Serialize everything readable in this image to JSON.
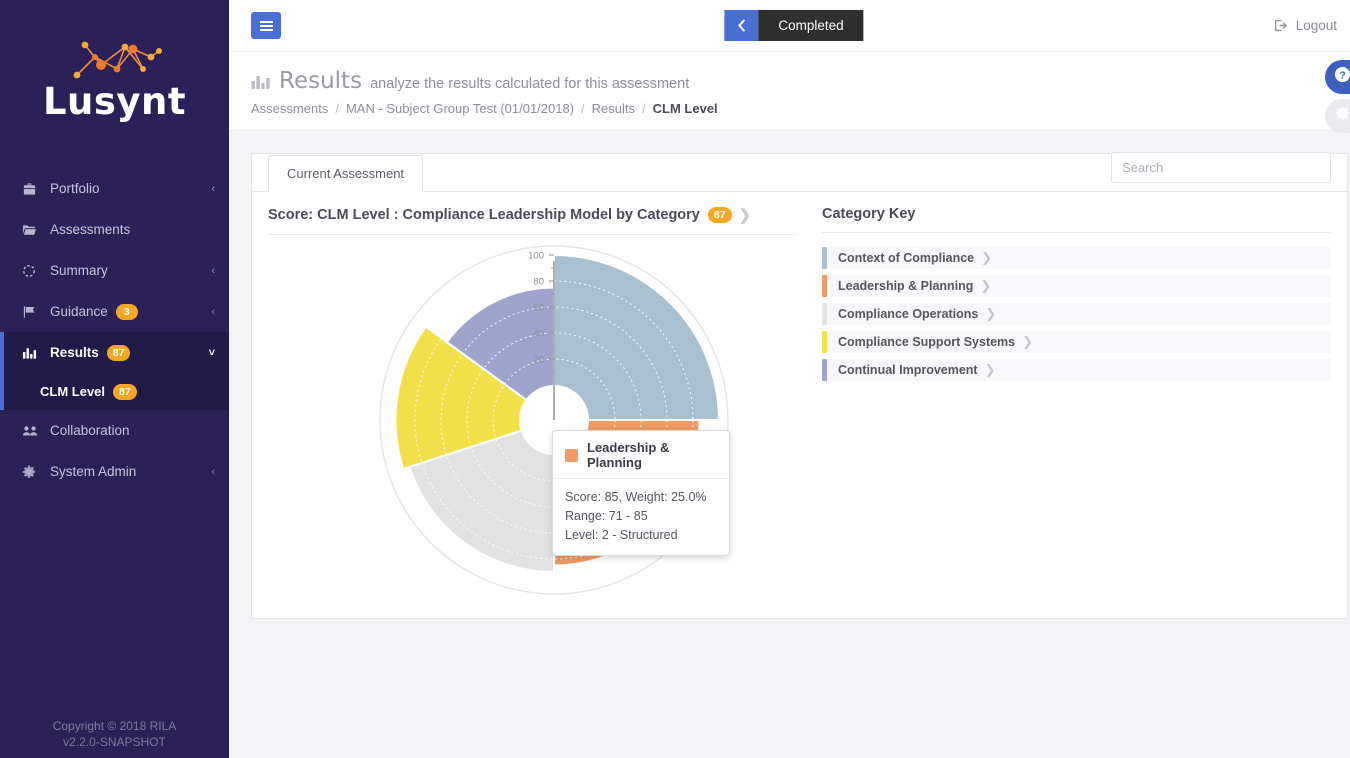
{
  "brand": {
    "name": "Lusynt",
    "logo_icon": "network-logo-icon"
  },
  "sidebar": {
    "items": [
      {
        "label": "Portfolio",
        "icon": "briefcase-icon",
        "chevron": "‹",
        "badge": null
      },
      {
        "label": "Assessments",
        "icon": "folder-open-icon",
        "chevron": "",
        "badge": null
      },
      {
        "label": "Summary",
        "icon": "circle-dashed-icon",
        "chevron": "‹",
        "badge": null
      },
      {
        "label": "Guidance",
        "icon": "flag-icon",
        "chevron": "‹",
        "badge": "3"
      },
      {
        "label": "Results",
        "icon": "bar-chart-icon",
        "chevron": "˅",
        "badge": "87"
      },
      {
        "label": "Collaboration",
        "icon": "users-icon",
        "chevron": "",
        "badge": null
      },
      {
        "label": "System Admin",
        "icon": "gear-icon",
        "chevron": "‹",
        "badge": null
      }
    ],
    "subitem": {
      "label": "CLM Level",
      "badge": "87"
    },
    "footer": {
      "copyright": "Copyright © 2018 RILA",
      "version": "v2.2.0-SNAPSHOT"
    }
  },
  "topbar": {
    "menu_icon": "hamburger-icon",
    "back_icon": "chevron-left-icon",
    "status": "Completed",
    "logout": "Logout",
    "logout_icon": "logout-icon"
  },
  "page_header": {
    "icon": "bar-chart-icon",
    "title": "Results",
    "subtitle": "analyze the results calculated for this assessment",
    "breadcrumb": [
      {
        "label": "Assessments",
        "current": false
      },
      {
        "label": "MAN - Subject Group Test (01/01/2018)",
        "current": false
      },
      {
        "label": "Results",
        "current": false
      },
      {
        "label": "CLM Level",
        "current": true
      }
    ],
    "breadcrumb_separator": "/"
  },
  "panel": {
    "tab": "Current Assessment",
    "search_placeholder": "Search",
    "search_value": "",
    "chart_title": "Score: CLM Level : Compliance Leadership Model by Category",
    "chart_title_badge": "87",
    "chart_title_chevron": "❯",
    "key_title": "Category Key"
  },
  "category_key": {
    "chevron": "❯",
    "items": [
      {
        "label": "Context of Compliance",
        "color": "#a8c0cf"
      },
      {
        "label": "Leadership & Planning",
        "color": "#f09a64"
      },
      {
        "label": "Compliance Operations",
        "color": "#e2e2e2"
      },
      {
        "label": "Compliance Support Systems",
        "color": "#f2e04a"
      },
      {
        "label": "Continual Improvement",
        "color": "#9fa4cd"
      }
    ]
  },
  "tooltip": {
    "title": "Leadership & Planning",
    "color": "#f09a64",
    "line1": "Score: 85,  Weight: 25.0%",
    "line2": "Range: 71 - 85",
    "line3": "Level: 2 - Structured"
  },
  "fab": {
    "help_icon": "help-circle-icon",
    "gear_icon": "gear-icon"
  },
  "chart_data": {
    "type": "pie",
    "subtype": "polar-rose",
    "title": "Score: CLM Level : Compliance Leadership Model by Category",
    "total_score": 87,
    "value_axis": {
      "label": "Score",
      "ticks": [
        20,
        40,
        60,
        80,
        100
      ],
      "min": 0,
      "max": 100,
      "grid": true
    },
    "grid": true,
    "legend_position": "right",
    "inner_hole_radius_pct": 20,
    "categories": [
      "Context of Compliance",
      "Leadership & Planning",
      "Compliance Operations",
      "Compliance Support Systems",
      "Continual Improvement"
    ],
    "series": [
      {
        "name": "Score",
        "values": [
          100,
          85,
          90,
          95,
          75
        ]
      },
      {
        "name": "Weight",
        "values": [
          25.0,
          25.0,
          20.0,
          15.0,
          15.0
        ]
      }
    ],
    "slices": [
      {
        "label": "Context of Compliance",
        "color": "#a8c0cf",
        "score": 100,
        "weight_pct": 25.0,
        "start_angle_deg": 0,
        "end_angle_deg": 90
      },
      {
        "label": "Leadership & Planning",
        "color": "#f09a64",
        "score": 85,
        "weight_pct": 25.0,
        "start_angle_deg": 90,
        "end_angle_deg": 180,
        "range": "71 - 85",
        "level": "2 - Structured",
        "highlighted": true
      },
      {
        "label": "Compliance Operations",
        "color": "#e2e2e2",
        "score": 90,
        "weight_pct": 20.0,
        "start_angle_deg": 180,
        "end_angle_deg": 252
      },
      {
        "label": "Compliance Support Systems",
        "color": "#f2e04a",
        "score": 95,
        "weight_pct": 15.0,
        "start_angle_deg": 252,
        "end_angle_deg": 306
      },
      {
        "label": "Continual Improvement",
        "color": "#9fa4cd",
        "score": 75,
        "weight_pct": 15.0,
        "start_angle_deg": 306,
        "end_angle_deg": 360
      }
    ],
    "axis_tick_labels": [
      "100",
      "80",
      "60",
      "40",
      "20"
    ]
  }
}
